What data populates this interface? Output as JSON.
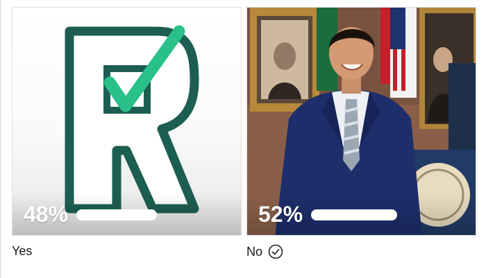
{
  "poll": {
    "options": [
      {
        "label": "Yes",
        "percent_text": "48%",
        "percent": 48,
        "selected": false,
        "image": "r-checkmark-logo"
      },
      {
        "label": "No",
        "percent_text": "52%",
        "percent": 52,
        "selected": true,
        "image": "portrait-man-in-suit"
      }
    ]
  },
  "colors": {
    "logo_green": "#1d5e52",
    "check_green": "#29c08a",
    "suit_navy": "#1d2e6b"
  }
}
